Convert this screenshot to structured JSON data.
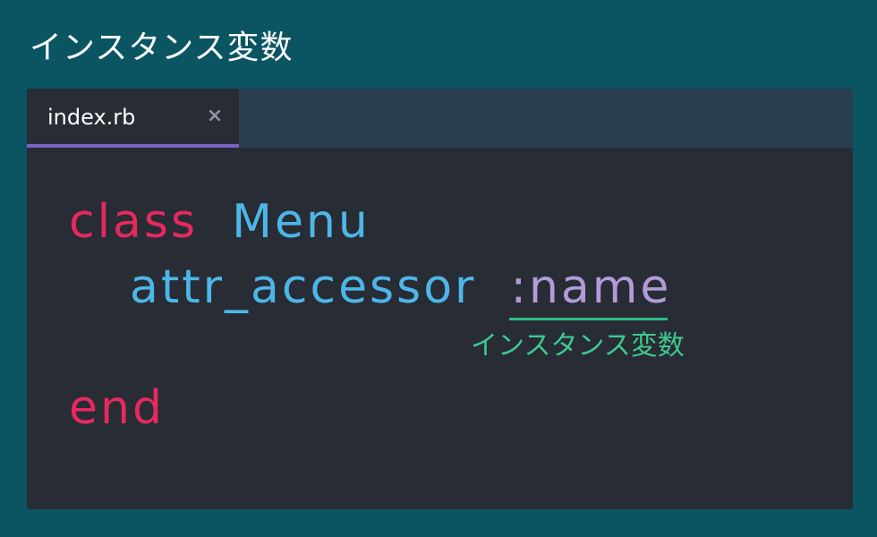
{
  "page": {
    "title": "インスタンス変数"
  },
  "editor": {
    "tab": {
      "label": "index.rb",
      "close_glyph": "×"
    },
    "code": {
      "line1": {
        "keyword": "class",
        "class_name": "Menu"
      },
      "line2": {
        "method": "attr_accessor",
        "symbol": ":name"
      },
      "line3": {
        "keyword": "end"
      }
    },
    "annotation": "インスタンス変数"
  },
  "colors": {
    "background": "#0b5563",
    "editor_bg": "#282c34",
    "tab_bar_bg": "#2b3e50",
    "tab_indicator": "#7a64c2",
    "keyword": "#e6295f",
    "identifier": "#4db6e8",
    "symbol": "#b19bd8",
    "annotation": "#3fc88f"
  }
}
